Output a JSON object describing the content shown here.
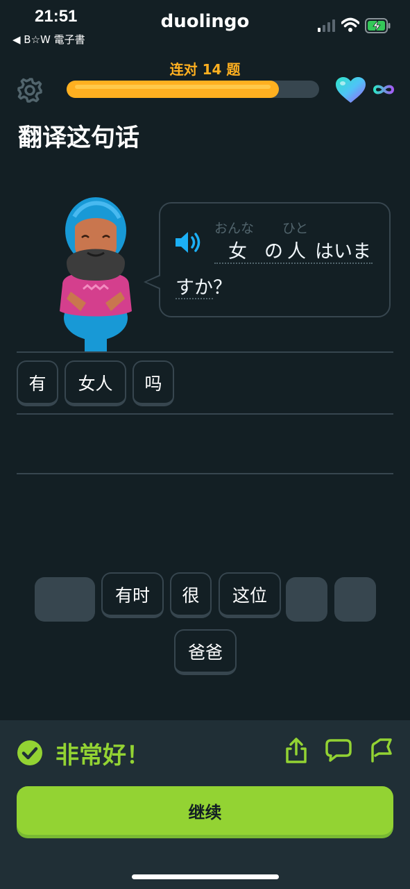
{
  "status_bar": {
    "time": "21:51",
    "back_app": "◀ B☆W 電子書",
    "brand": "duolingo",
    "icons": [
      "signal-icon",
      "wifi-icon",
      "battery-charging-icon"
    ]
  },
  "header": {
    "streak_text": "连对 14 题",
    "progress": 0.84,
    "hearts": "∞",
    "icons": [
      "gear-icon",
      "heart-icon",
      "infinity-icon"
    ]
  },
  "challenge": {
    "title": "翻译这句话",
    "prompt": {
      "tokens": [
        {
          "furigana": "おんな",
          "text": "女"
        },
        {
          "furigana": "",
          "text": "の"
        },
        {
          "furigana": "ひと",
          "text": "人"
        },
        {
          "furigana": "",
          "text": "はいま"
        }
      ],
      "line2": "すか？"
    }
  },
  "answer_tiles": [
    "有",
    "女人",
    "吗"
  ],
  "word_bank": [
    "有时",
    "很",
    "这位",
    "爸爸"
  ],
  "feedback": {
    "message": "非常好！",
    "continue_label": "继续",
    "icons": [
      "check-circle-icon",
      "share-icon",
      "comment-icon",
      "flag-icon"
    ]
  },
  "colors": {
    "background": "#131f24",
    "accent_orange": "#ffb020",
    "accent_green": "#93d333",
    "tile_border": "#37464f",
    "speaker_blue": "#1cb0f6"
  }
}
